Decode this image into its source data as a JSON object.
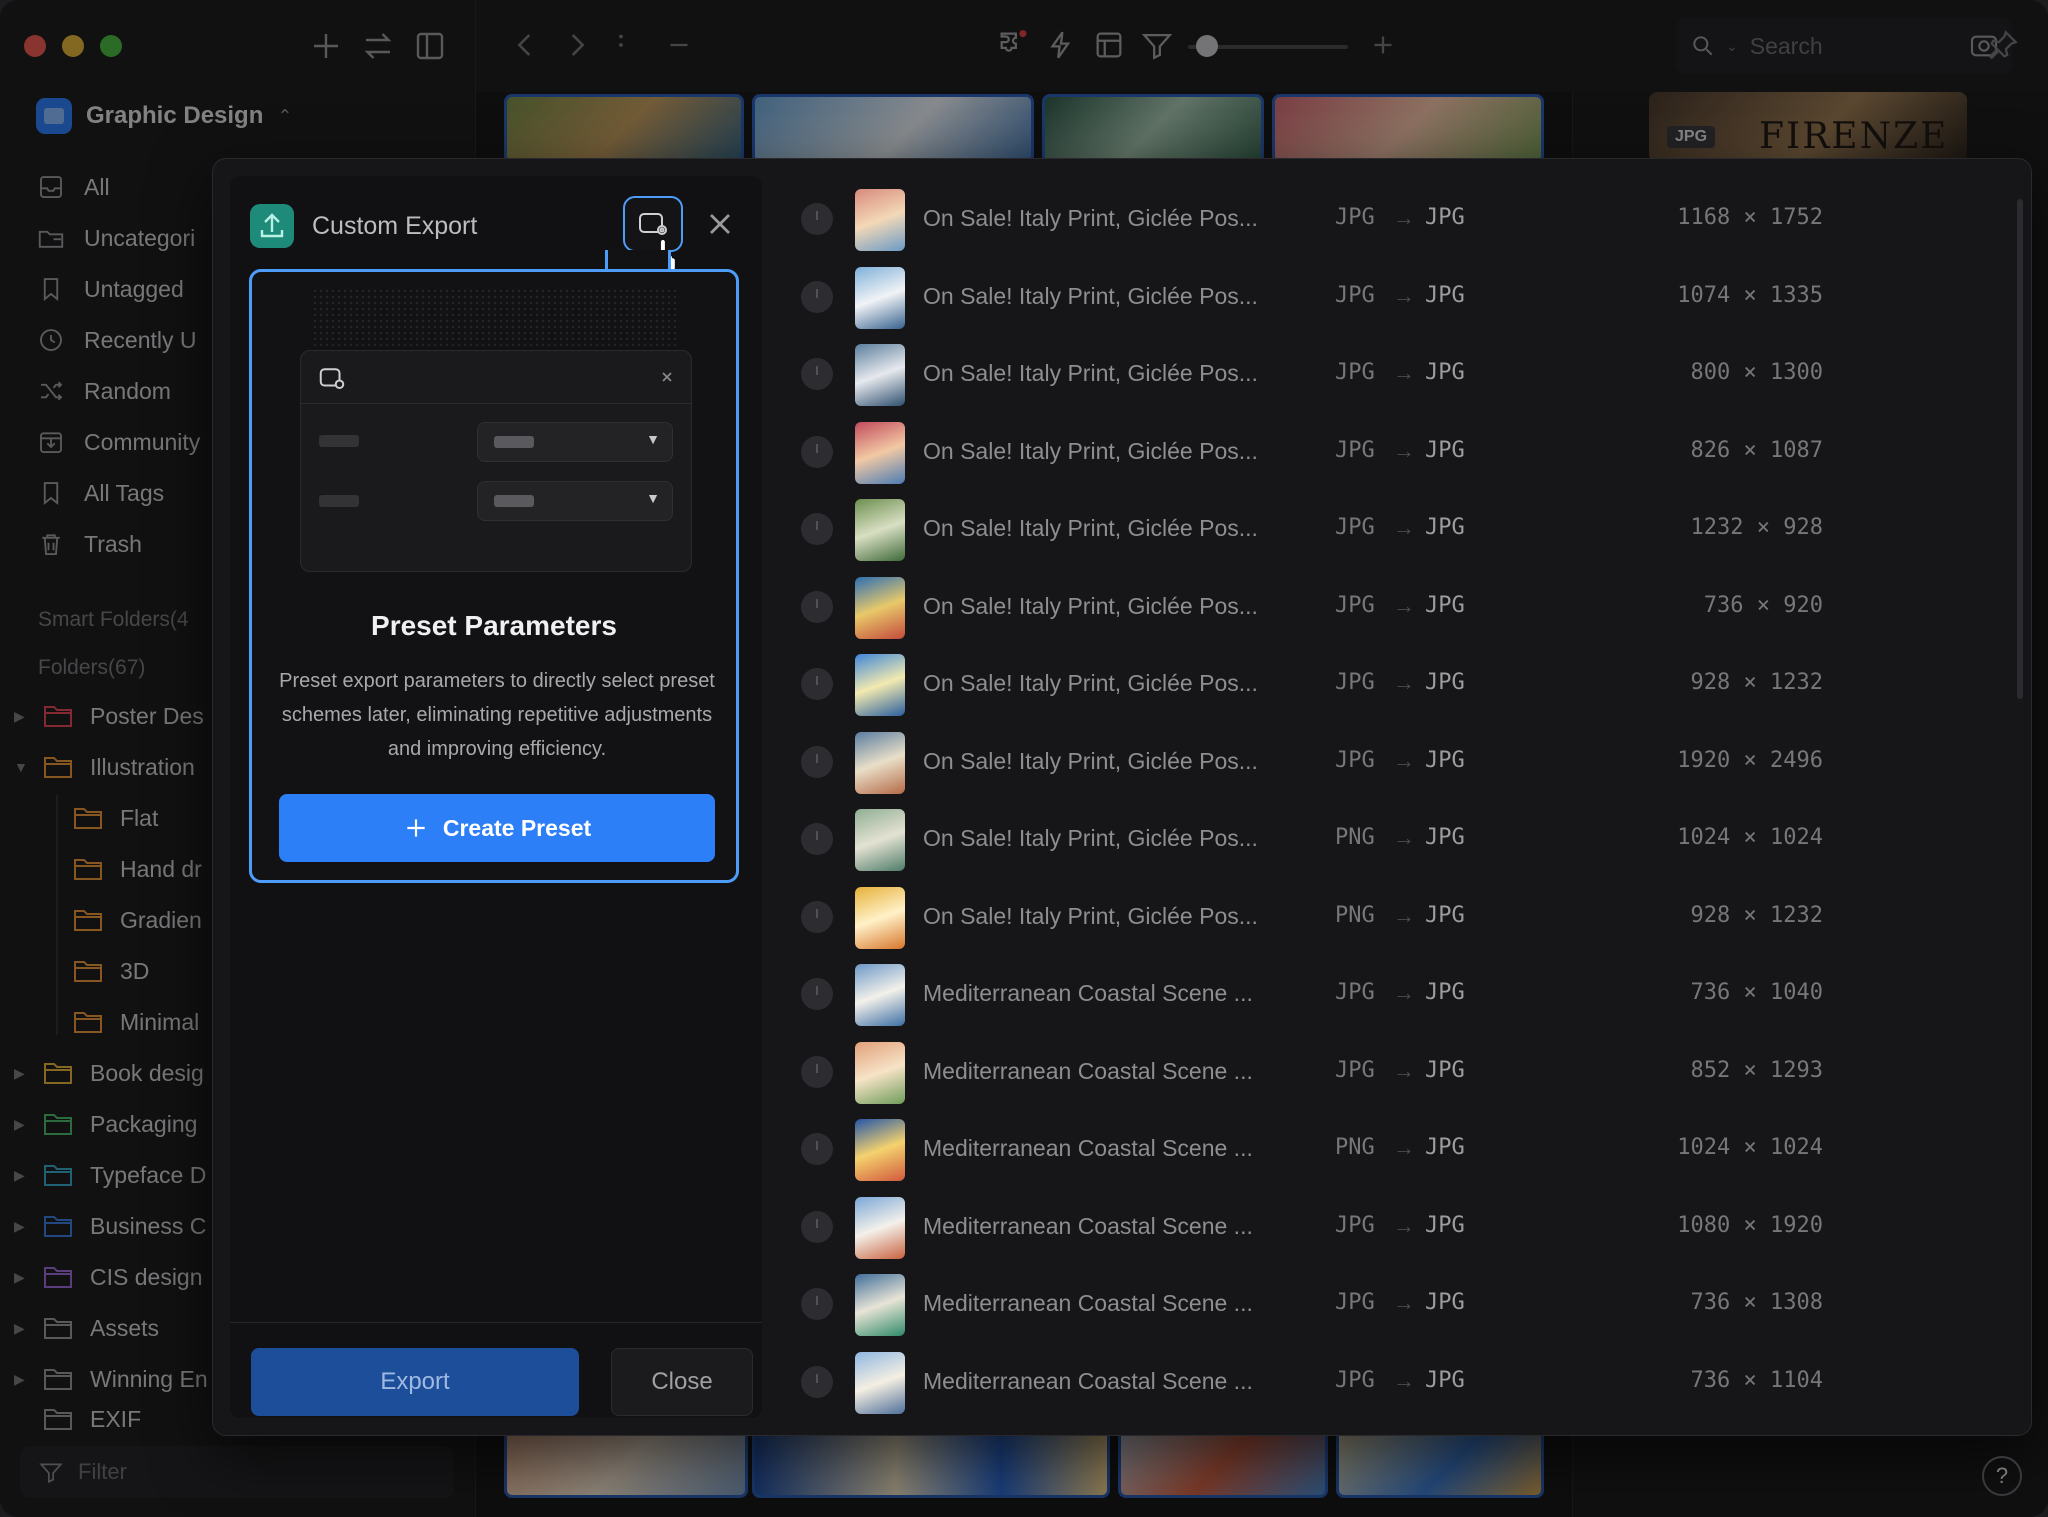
{
  "library": {
    "name": "Graphic Design"
  },
  "sidebar": {
    "nav": [
      {
        "label": "All",
        "icon": "inbox-icon"
      },
      {
        "label": "Uncategori",
        "icon": "folder-question-icon"
      },
      {
        "label": "Untagged",
        "icon": "tag-off-icon"
      },
      {
        "label": "Recently U",
        "icon": "clock-icon"
      },
      {
        "label": "Random",
        "icon": "shuffle-icon"
      },
      {
        "label": "Community",
        "icon": "download-box-icon"
      },
      {
        "label": "All Tags",
        "icon": "bookmark-icon"
      },
      {
        "label": "Trash",
        "icon": "trash-icon"
      }
    ],
    "smart_folders": "Smart Folders(4",
    "folders_title": "Folders(67)",
    "folders": [
      {
        "label": "Poster Des",
        "color": "#e0475a"
      },
      {
        "label": "Illustration",
        "color": "#e8953a"
      },
      {
        "label": "Flat",
        "color": "#e8953a"
      },
      {
        "label": "Hand dr",
        "color": "#e8953a"
      },
      {
        "label": "Gradien",
        "color": "#e8953a"
      },
      {
        "label": "3D",
        "color": "#e8953a"
      },
      {
        "label": "Minimal",
        "color": "#e8953a"
      },
      {
        "label": "Book desig",
        "color": "#e6b13a"
      },
      {
        "label": "Packaging",
        "color": "#4cb86a"
      },
      {
        "label": "Typeface D",
        "color": "#3aa7c9"
      },
      {
        "label": "Business C",
        "color": "#3b7de0"
      },
      {
        "label": "CIS design",
        "color": "#9b6ad6"
      },
      {
        "label": "Assets",
        "color": "#9a9a9e"
      },
      {
        "label": "Winning En",
        "color": "#9a9a9e"
      },
      {
        "label": "EXIF",
        "color": "#9a9a9e"
      }
    ],
    "filter_placeholder": "Filter"
  },
  "toolbar": {
    "search_placeholder": "Search",
    "zoom_level": 0.1
  },
  "inspector": {
    "format_badge": "JPG",
    "image_text": "FIRENZE"
  },
  "export_dialog": {
    "title": "Custom Export",
    "popover": {
      "title": "Preset Parameters",
      "description": "Preset export parameters to directly select preset schemes later, eliminating repetitive adjustments and improving efficiency.",
      "create_label": "Create Preset"
    },
    "export_label": "Export",
    "close_label": "Close",
    "arrow": "→",
    "files": [
      {
        "name": "On Sale! Italy Print, Giclée Pos...",
        "from": "JPG",
        "to": "JPG",
        "size": "1168 × 1752"
      },
      {
        "name": "On Sale! Italy Print, Giclée Pos...",
        "from": "JPG",
        "to": "JPG",
        "size": "1074 × 1335"
      },
      {
        "name": "On Sale! Italy Print, Giclée Pos...",
        "from": "JPG",
        "to": "JPG",
        "size": "800 × 1300"
      },
      {
        "name": "On Sale! Italy Print, Giclée Pos...",
        "from": "JPG",
        "to": "JPG",
        "size": "826 × 1087"
      },
      {
        "name": "On Sale! Italy Print, Giclée Pos...",
        "from": "JPG",
        "to": "JPG",
        "size": "1232 × 928"
      },
      {
        "name": "On Sale! Italy Print, Giclée Pos...",
        "from": "JPG",
        "to": "JPG",
        "size": "736 × 920"
      },
      {
        "name": "On Sale! Italy Print, Giclée Pos...",
        "from": "JPG",
        "to": "JPG",
        "size": "928 × 1232"
      },
      {
        "name": "On Sale! Italy Print, Giclée Pos...",
        "from": "JPG",
        "to": "JPG",
        "size": "1920 × 2496"
      },
      {
        "name": "On Sale! Italy Print, Giclée Pos...",
        "from": "PNG",
        "to": "JPG",
        "size": "1024 × 1024"
      },
      {
        "name": "On Sale! Italy Print, Giclée Pos...",
        "from": "PNG",
        "to": "JPG",
        "size": "928 × 1232"
      },
      {
        "name": "Mediterranean Coastal Scene ...",
        "from": "JPG",
        "to": "JPG",
        "size": "736 × 1040"
      },
      {
        "name": "Mediterranean Coastal Scene ...",
        "from": "JPG",
        "to": "JPG",
        "size": "852 × 1293"
      },
      {
        "name": "Mediterranean Coastal Scene ...",
        "from": "PNG",
        "to": "JPG",
        "size": "1024 × 1024"
      },
      {
        "name": "Mediterranean Coastal Scene ...",
        "from": "JPG",
        "to": "JPG",
        "size": "1080 × 1920"
      },
      {
        "name": "Mediterranean Coastal Scene ...",
        "from": "JPG",
        "to": "JPG",
        "size": "736 × 1308"
      },
      {
        "name": "Mediterranean Coastal Scene ...",
        "from": "JPG",
        "to": "JPG",
        "size": "736 × 1104"
      }
    ]
  },
  "colors": {
    "accent": "#2c7ff7",
    "highlight_border": "#4d9df8"
  },
  "help_label": "?"
}
